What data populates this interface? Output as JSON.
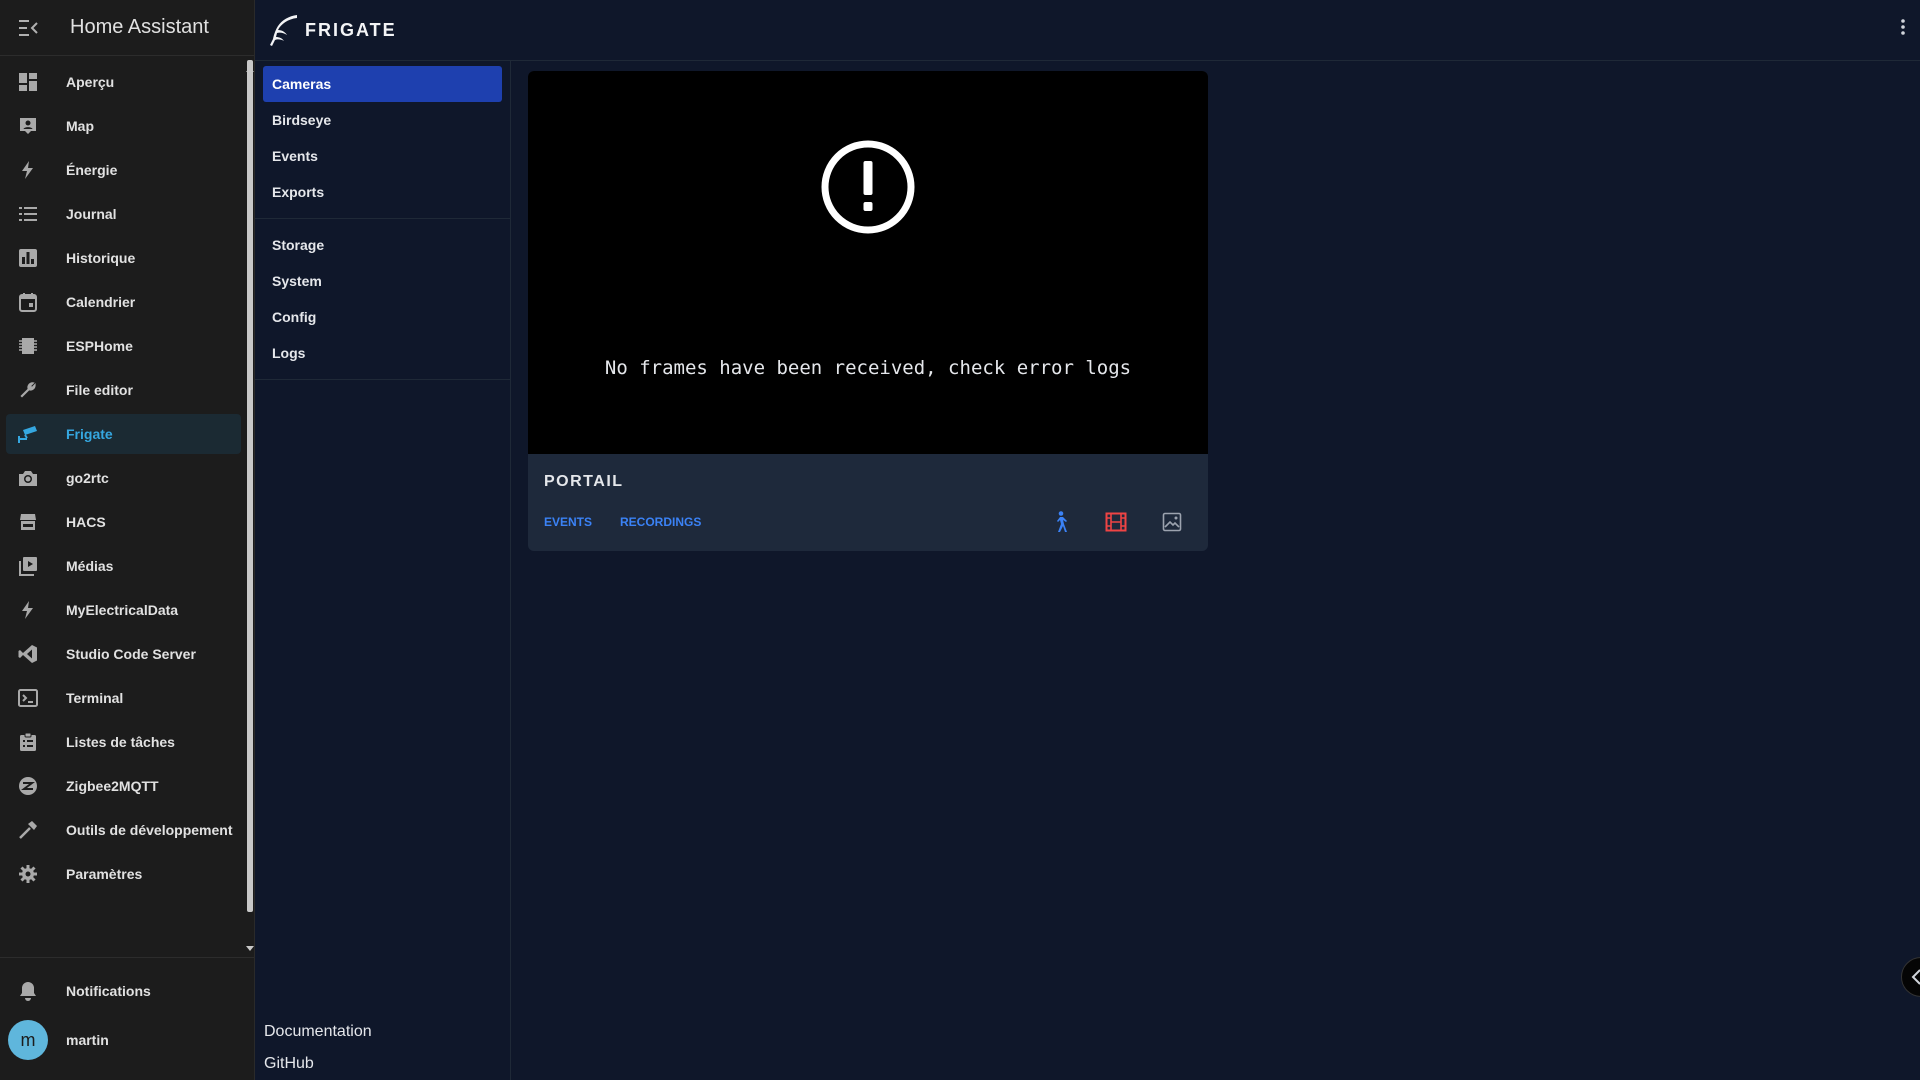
{
  "ha": {
    "title": "Home Assistant",
    "menu_icon": "menu-collapse-icon",
    "items": [
      {
        "label": "Aperçu",
        "icon": "dashboard-icon"
      },
      {
        "label": "Map",
        "icon": "map-account-icon"
      },
      {
        "label": "Énergie",
        "icon": "lightning-icon"
      },
      {
        "label": "Journal",
        "icon": "list-icon"
      },
      {
        "label": "Historique",
        "icon": "chart-box-icon"
      },
      {
        "label": "Calendrier",
        "icon": "calendar-icon"
      },
      {
        "label": "ESPHome",
        "icon": "chip-icon"
      },
      {
        "label": "File editor",
        "icon": "wrench-icon"
      },
      {
        "label": "Frigate",
        "icon": "cctv-icon",
        "active": true
      },
      {
        "label": "go2rtc",
        "icon": "camera-icon"
      },
      {
        "label": "HACS",
        "icon": "hacs-icon"
      },
      {
        "label": "Médias",
        "icon": "play-box-icon"
      },
      {
        "label": "MyElectricalData",
        "icon": "lightning-icon"
      },
      {
        "label": "Studio Code Server",
        "icon": "vscode-icon"
      },
      {
        "label": "Terminal",
        "icon": "console-icon"
      },
      {
        "label": "Listes de tâches",
        "icon": "clipboard-list-icon"
      },
      {
        "label": "Zigbee2MQTT",
        "icon": "zigbee-icon"
      },
      {
        "label": "Outils de développement",
        "icon": "hammer-icon"
      },
      {
        "label": "Paramètres",
        "icon": "cog-icon"
      }
    ],
    "notifications": "Notifications",
    "user": {
      "initial": "m",
      "name": "martin"
    },
    "accent": "#35a7e0"
  },
  "frigate": {
    "logo_text": "FRIGATE",
    "nav_group1": [
      "Cameras",
      "Birdseye",
      "Events",
      "Exports"
    ],
    "nav_group2": [
      "Storage",
      "System",
      "Config",
      "Logs"
    ],
    "footer": [
      "Documentation",
      "GitHub"
    ],
    "accent": "#1e40af"
  },
  "camera": {
    "name": "PORTAIL",
    "message": "No frames have been received, check error logs",
    "links": {
      "events": "EVENTS",
      "recordings": "RECORDINGS"
    },
    "toggles": [
      {
        "icon": "person-walking-icon",
        "color": "#3b82f6"
      },
      {
        "icon": "film-icon",
        "color": "#ef4444"
      },
      {
        "icon": "image-icon",
        "color": "#9ca3af"
      }
    ]
  }
}
